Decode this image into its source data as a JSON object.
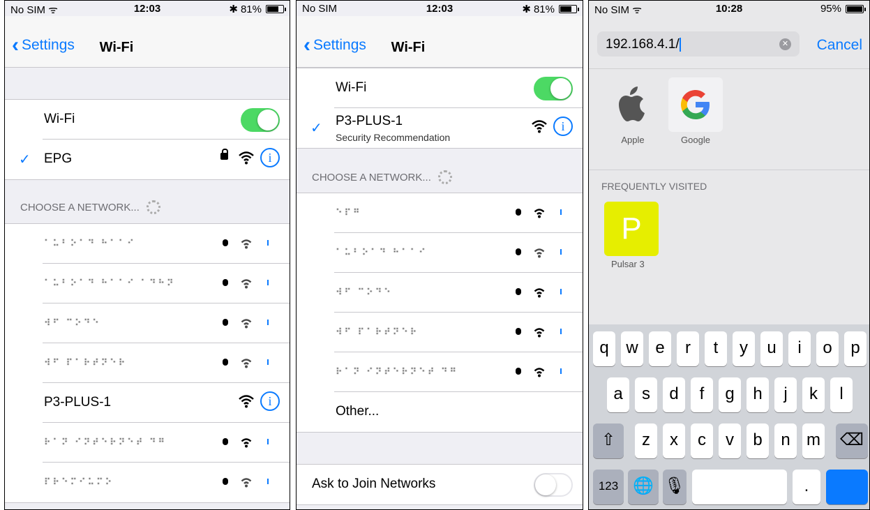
{
  "screens": [
    {
      "status": {
        "carrier": "No SIM",
        "time": "12:03",
        "battery": "81%",
        "battery_level": 0.81
      },
      "nav": {
        "back": "Settings",
        "title": "Wi-Fi"
      },
      "wifi_label": "Wi-Fi",
      "connected": "EPG",
      "section_header": "CHOOSE A NETWORK...",
      "networks": [
        "P3-PLUS-1"
      ]
    },
    {
      "status": {
        "carrier": "No SIM",
        "time": "12:03",
        "battery": "81%",
        "battery_level": 0.81
      },
      "nav": {
        "back": "Settings",
        "title": "Wi-Fi"
      },
      "wifi_label": "Wi-Fi",
      "connected": "P3-PLUS-1",
      "connected_sub": "Security Recommendation",
      "section_header": "CHOOSE A NETWORK...",
      "other": "Other...",
      "ask_to_join": "Ask to Join Networks"
    },
    {
      "status": {
        "carrier": "No SIM",
        "time": "10:28",
        "battery": "95%",
        "battery_level": 0.95
      },
      "url": "192.168.4.1/",
      "cancel": "Cancel",
      "favorites": [
        "Apple",
        "Google"
      ],
      "frequent_header": "FREQUENTLY VISITED",
      "frequent": [
        {
          "letter": "P",
          "label": "Pulsar 3"
        }
      ],
      "keys_row1": [
        "q",
        "w",
        "e",
        "r",
        "t",
        "y",
        "u",
        "i",
        "o",
        "p"
      ],
      "keys_row2": [
        "a",
        "s",
        "d",
        "f",
        "g",
        "h",
        "j",
        "k",
        "l"
      ],
      "keys_row3": [
        "z",
        "x",
        "c",
        "v",
        "b",
        "n",
        "m"
      ],
      "key_123": "123",
      "key_dot": "."
    }
  ]
}
